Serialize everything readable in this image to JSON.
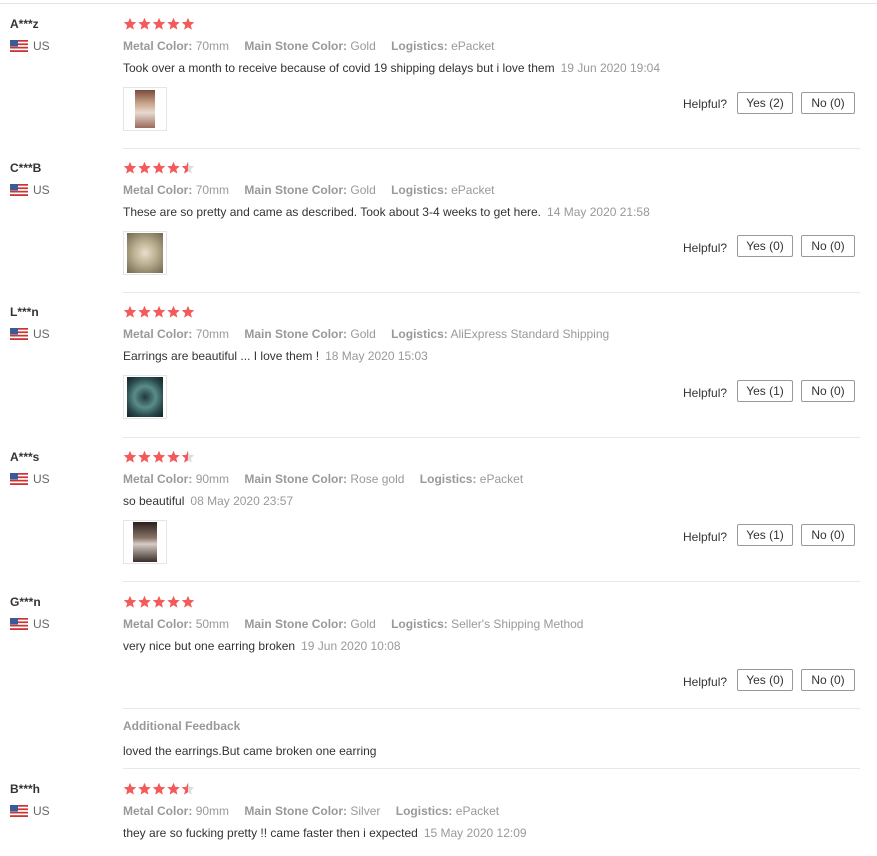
{
  "labels": {
    "metal": "Metal Color:",
    "stone": "Main Stone Color:",
    "logistics": "Logistics:",
    "helpful": "Helpful?",
    "additional": "Additional Feedback"
  },
  "colors": {
    "star": "#f45a5a",
    "accent": "#e62e04"
  },
  "reviews": [
    {
      "user": "A***z",
      "country": "US",
      "rating": 5,
      "metal": "70mm",
      "stone": "Gold",
      "logistics": "ePacket",
      "text": "Took over a month to receive because of covid 19 shipping delays but i love them",
      "date": "19 Jun 2020 19:04",
      "yes": "Yes (2)",
      "no": "No (0)"
    },
    {
      "user": "C***B",
      "country": "US",
      "rating": 4.5,
      "metal": "70mm",
      "stone": "Gold",
      "logistics": "ePacket",
      "text": "These are so pretty and came as described. Took about 3-4 weeks to get here.",
      "date": "14 May 2020 21:58",
      "yes": "Yes (0)",
      "no": "No (0)"
    },
    {
      "user": "L***n",
      "country": "US",
      "rating": 5,
      "metal": "70mm",
      "stone": "Gold",
      "logistics": "AliExpress Standard Shipping",
      "text": "Earrings are beautiful ... I love them !",
      "date": "18 May 2020 15:03",
      "yes": "Yes (1)",
      "no": "No (0)"
    },
    {
      "user": "A***s",
      "country": "US",
      "rating": 4.5,
      "metal": "90mm",
      "stone": "Rose gold",
      "logistics": "ePacket",
      "text": "so beautiful",
      "date": "08 May 2020 23:57",
      "yes": "Yes (1)",
      "no": "No (0)"
    },
    {
      "user": "G***n",
      "country": "US",
      "rating": 5,
      "metal": "50mm",
      "stone": "Gold",
      "logistics": "Seller's Shipping Method",
      "text": "very nice but one earring broken",
      "date": "19 Jun 2020 10:08",
      "yes": "Yes (0)",
      "no": "No (0)",
      "additional": "loved the earrings.But came broken one earring"
    },
    {
      "user": "B***h",
      "country": "US",
      "rating": 4.5,
      "metal": "90mm",
      "stone": "Silver",
      "logistics": "ePacket",
      "text": "they are so fucking pretty !! came faster then i expected",
      "date": "15 May 2020 12:09"
    }
  ]
}
